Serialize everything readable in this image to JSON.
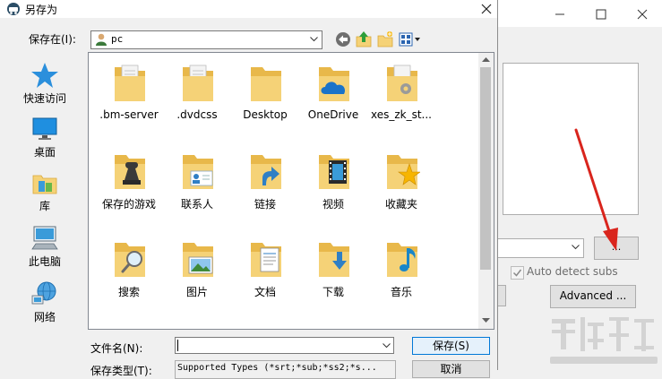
{
  "dialog": {
    "title": "另存为",
    "save_in_label": "保存在(I):",
    "current_path": "pc",
    "file_name_label": "文件名(N):",
    "file_name_value": "",
    "file_type_label": "保存类型(T):",
    "file_type_value": "Supported Types (*srt;*sub;*ss2;*s...",
    "save_button": "保存(S)",
    "cancel_button": "取消"
  },
  "places": [
    {
      "label": "快速访问",
      "icon": "quick-access-star-icon"
    },
    {
      "label": "桌面",
      "icon": "desktop-icon"
    },
    {
      "label": "库",
      "icon": "libraries-icon"
    },
    {
      "label": "此电脑",
      "icon": "this-pc-icon"
    },
    {
      "label": "网络",
      "icon": "network-icon"
    }
  ],
  "files": [
    {
      "label": ".bm-server",
      "icon": "folder-document-icon"
    },
    {
      "label": ".dvdcss",
      "icon": "folder-document-icon"
    },
    {
      "label": "Desktop",
      "icon": "folder-icon"
    },
    {
      "label": "OneDrive",
      "icon": "onedrive-folder-icon"
    },
    {
      "label": "xes_zk_st...",
      "icon": "folder-settings-icon"
    },
    {
      "label": "保存的游戏",
      "icon": "saved-games-folder-icon"
    },
    {
      "label": "联系人",
      "icon": "contacts-folder-icon"
    },
    {
      "label": "链接",
      "icon": "links-folder-icon"
    },
    {
      "label": "视频",
      "icon": "videos-folder-icon"
    },
    {
      "label": "收藏夹",
      "icon": "favorites-folder-icon"
    },
    {
      "label": "搜索",
      "icon": "searches-folder-icon"
    },
    {
      "label": "图片",
      "icon": "pictures-folder-icon"
    },
    {
      "label": "文档",
      "icon": "documents-folder-icon"
    },
    {
      "label": "下载",
      "icon": "downloads-folder-icon"
    },
    {
      "label": "音乐",
      "icon": "music-folder-icon"
    }
  ],
  "background_app": {
    "browse_button": "...",
    "auto_detect_subs_label": "Auto detect subs",
    "auto_detect_subs_checked": true,
    "advanced_button": "Advanced ..."
  },
  "colors": {
    "folder": "#f5d277",
    "folder_dark": "#e8b84a",
    "accent": "#0078d7",
    "annotation_arrow": "#d9251d"
  }
}
